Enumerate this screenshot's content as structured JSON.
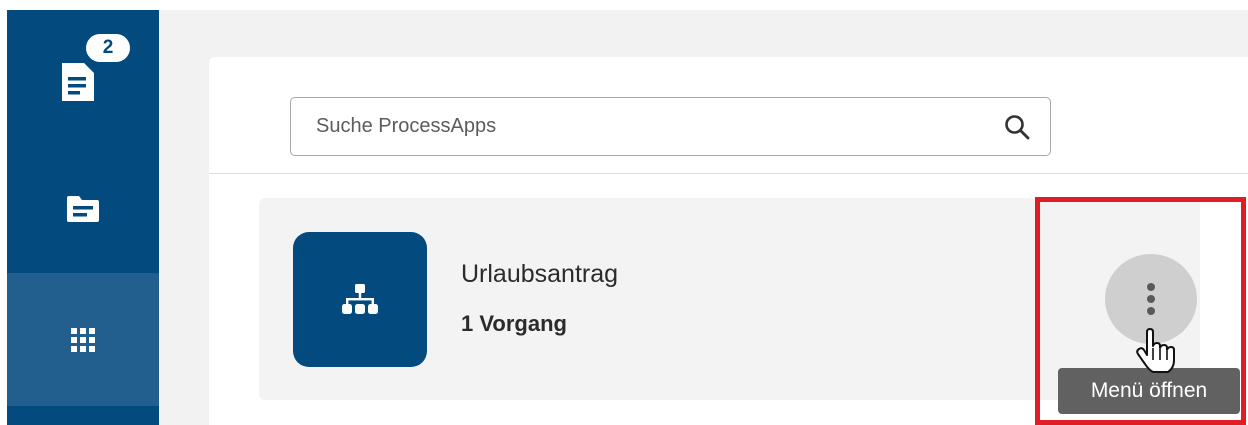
{
  "sidebar": {
    "items": [
      {
        "name": "tasks",
        "icon": "task-list-icon",
        "badge": "2"
      },
      {
        "name": "files",
        "icon": "file-folder-icon"
      },
      {
        "name": "process-apps",
        "icon": "grid-apps-icon",
        "active": true
      }
    ]
  },
  "search": {
    "placeholder": "Suche ProcessApps",
    "value": "",
    "icon": "search-icon"
  },
  "process_app": {
    "name": "Urlaubsantrag",
    "count": "1 Vorgang",
    "icon": "org-chart-icon"
  },
  "menu": {
    "tooltip": "Menü öffnen",
    "icon": "kebab-menu-icon"
  },
  "colors": {
    "sidebar": "#034b7e",
    "sidebar_active": "#225f8e",
    "highlight": "#e01c24",
    "tooltip": "#616161"
  }
}
